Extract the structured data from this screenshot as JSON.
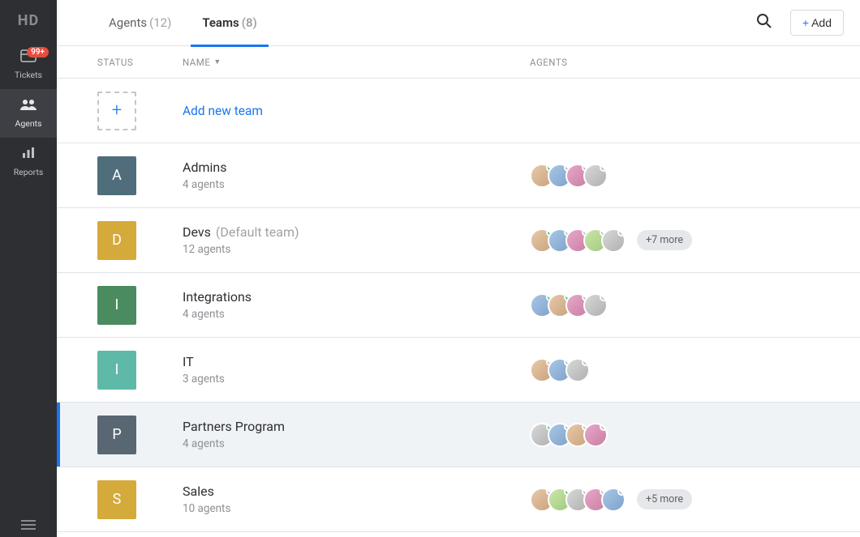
{
  "brand": "HD",
  "sidebar": {
    "items": [
      {
        "icon": "ticket",
        "label": "Tickets",
        "badge": "99+"
      },
      {
        "icon": "agents",
        "label": "Agents",
        "active": true
      },
      {
        "icon": "reports",
        "label": "Reports"
      }
    ]
  },
  "tabs": {
    "agents": {
      "label": "Agents",
      "count": "(12)"
    },
    "teams": {
      "label": "Teams",
      "count": "(8)",
      "active": true
    }
  },
  "actions": {
    "add_label": "Add",
    "plus_glyph": "+"
  },
  "columns": {
    "status": "STATUS",
    "name": "NAME",
    "agents": "AGENTS"
  },
  "add_row": {
    "label": "Add new team"
  },
  "teams": [
    {
      "letter": "A",
      "color": "#4f6d7a",
      "name": "Admins",
      "sub": "4 agents",
      "avatars": [
        {
          "cls": "c1",
          "status": "online"
        },
        {
          "cls": "c2",
          "status": "offline"
        },
        {
          "cls": "c3",
          "status": "offline"
        },
        {
          "cls": "c5",
          "status": "offline"
        }
      ]
    },
    {
      "letter": "D",
      "color": "#d4aa3a",
      "name": "Devs",
      "default_tag": "(Default team)",
      "sub": "12 agents",
      "avatars": [
        {
          "cls": "c1",
          "status": "online"
        },
        {
          "cls": "c2",
          "status": "offline"
        },
        {
          "cls": "c3",
          "status": "offline"
        },
        {
          "cls": "c4",
          "status": "offline"
        },
        {
          "cls": "c5",
          "status": "offline"
        }
      ],
      "more": "+7 more"
    },
    {
      "letter": "I",
      "color": "#4a8c5f",
      "name": "Integrations",
      "sub": "4 agents",
      "avatars": [
        {
          "cls": "c2",
          "status": "online"
        },
        {
          "cls": "c1",
          "status": "online"
        },
        {
          "cls": "c3",
          "status": "offline"
        },
        {
          "cls": "c5",
          "status": "offline"
        }
      ]
    },
    {
      "letter": "I",
      "color": "#5fb9a8",
      "name": "IT",
      "sub": "3 agents",
      "avatars": [
        {
          "cls": "c1",
          "status": "offline"
        },
        {
          "cls": "c2",
          "status": "offline"
        },
        {
          "cls": "c5",
          "status": "offline"
        }
      ]
    },
    {
      "letter": "P",
      "color": "#596773",
      "name": "Partners Program",
      "sub": "4 agents",
      "selected": true,
      "avatars": [
        {
          "cls": "c5",
          "status": "online"
        },
        {
          "cls": "c2",
          "status": "offline"
        },
        {
          "cls": "c1",
          "status": "offline"
        },
        {
          "cls": "c3",
          "status": "offline"
        }
      ]
    },
    {
      "letter": "S",
      "color": "#d4aa3a",
      "name": "Sales",
      "sub": "10 agents",
      "avatars": [
        {
          "cls": "c1",
          "status": "offline"
        },
        {
          "cls": "c4",
          "status": "online"
        },
        {
          "cls": "c5",
          "status": "offline"
        },
        {
          "cls": "c3",
          "status": "offline"
        },
        {
          "cls": "c2",
          "status": "offline"
        }
      ],
      "more": "+5 more"
    }
  ]
}
